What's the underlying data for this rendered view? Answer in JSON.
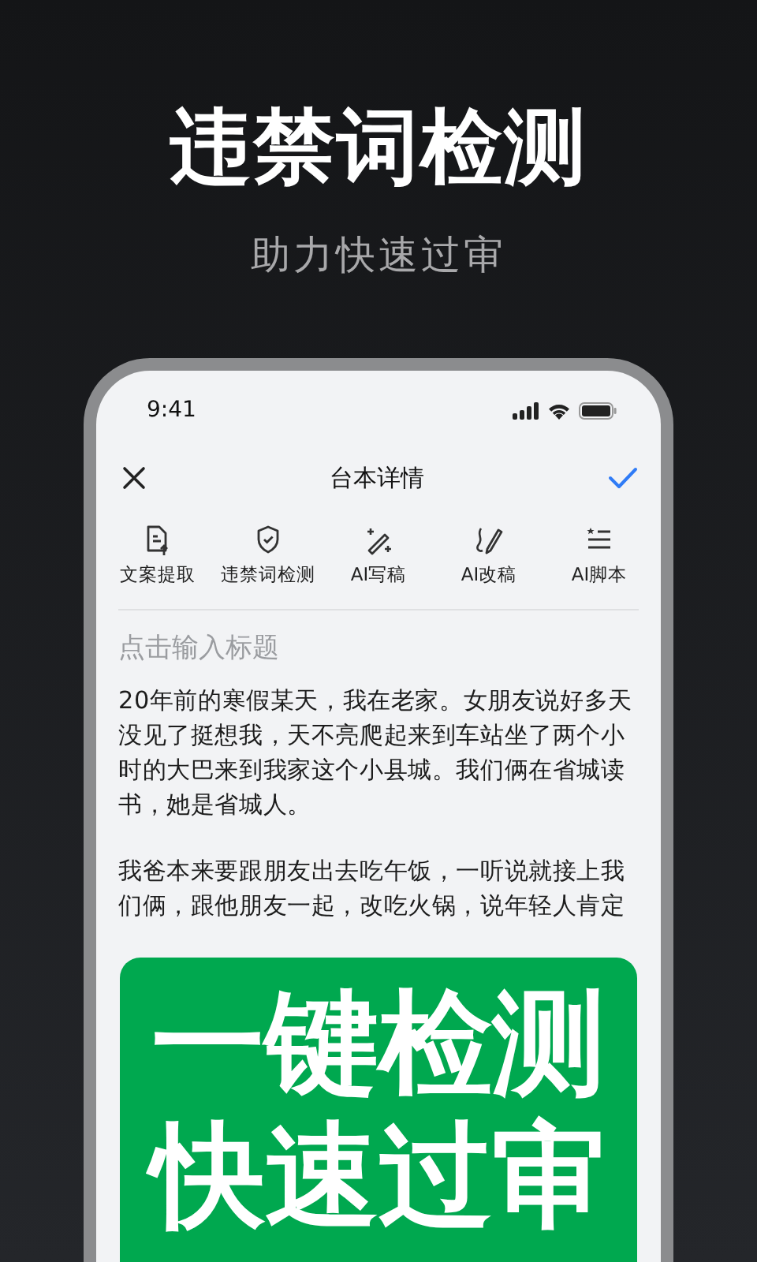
{
  "headline": "违禁词检测",
  "subtitle": "助力快速过审",
  "phone": {
    "status_bar": {
      "time": "9:41"
    },
    "nav": {
      "title": "台本详情"
    },
    "toolbar": [
      {
        "kind": "extract",
        "label": "文案提取"
      },
      {
        "kind": "shield",
        "label": "违禁词检测"
      },
      {
        "kind": "wand",
        "label": "AI写稿"
      },
      {
        "kind": "pen",
        "label": "AI改稿"
      },
      {
        "kind": "list",
        "label": "AI脚本"
      }
    ],
    "title_field": {
      "placeholder": "点击输入标题"
    },
    "paragraphs": [
      "20年前的寒假某天，我在老家。女朋友说好多天没见了挺想我，天不亮爬起来到车站坐了两个小时的大巴来到我家这个小县城。我们俩在省城读书，她是省城人。",
      "我爸本来要跟朋友出去吃午饭，一听说就接上我们俩，跟他朋友一起，改吃火锅，说年轻人肯定"
    ]
  },
  "banner": {
    "lines": [
      "一键检测",
      "快速过审"
    ]
  }
}
